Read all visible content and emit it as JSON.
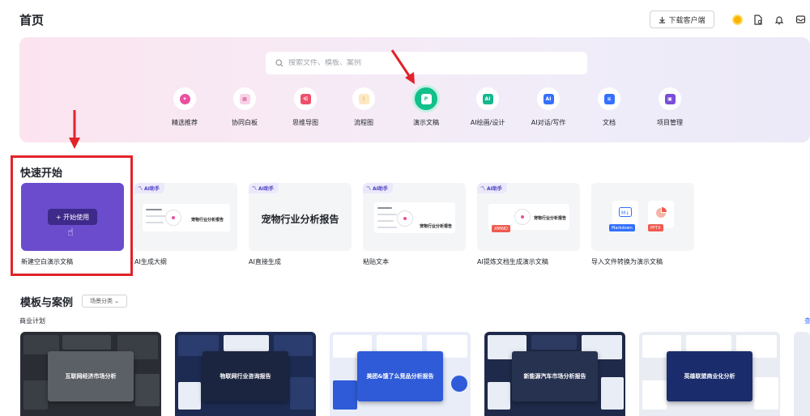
{
  "header": {
    "title": "首页",
    "download_label": "下载客户端"
  },
  "search": {
    "placeholder": "搜索文件、模板、案例"
  },
  "categories": [
    {
      "label": "精选推荐",
      "icon": "sparkle-icon",
      "color": "#e94fa0"
    },
    {
      "label": "协同白板",
      "icon": "whiteboard-icon",
      "color": "#e0549a"
    },
    {
      "label": "思维导图",
      "icon": "mindmap-icon",
      "color": "#ef4f6a"
    },
    {
      "label": "流程图",
      "icon": "flowchart-icon",
      "color": "#f5a623"
    },
    {
      "label": "演示文稿",
      "icon": "presentation-icon",
      "color": "#11c08a"
    },
    {
      "label": "AI绘画/设计",
      "icon": "ai-paint-icon",
      "color": "#14b88d"
    },
    {
      "label": "AI对话/写作",
      "icon": "ai-chat-icon",
      "color": "#3370ff"
    },
    {
      "label": "文档",
      "icon": "document-icon",
      "color": "#3370ff"
    },
    {
      "label": "项目管理",
      "icon": "project-icon",
      "color": "#7a4dd8"
    }
  ],
  "quick_start": {
    "title": "快速开始",
    "start_button": "+ 开始使用",
    "ai_badge": "AI助手",
    "big_title": "宠物行业分析报告",
    "mini_title": "宠物行业分析报告",
    "pill_markdown": "Markdown",
    "pill_pptx": "PPTX",
    "pill_xmind": "XMIND",
    "tiles": [
      {
        "caption": "新建空白演示文稿"
      },
      {
        "caption": "AI生成大纲"
      },
      {
        "caption": "AI直接生成"
      },
      {
        "caption": "粘贴文本"
      },
      {
        "caption": "AI提炼文档生成演示文稿"
      },
      {
        "caption": "导入文件转换为演示文稿"
      }
    ]
  },
  "templates": {
    "title": "模板与案例",
    "filter_label": "场景分类",
    "subsection": "商业计划",
    "see_all": "查",
    "items": [
      {
        "title": "互联网经济市场分析",
        "bg": "#2a2d33",
        "center": "#5b5f66"
      },
      {
        "title": "物联网行业咨询报告",
        "bg": "#1d2b52",
        "center": "#1c2540"
      },
      {
        "title": "美团&饿了么竞品分析报告",
        "bg": "#e8edf8",
        "center": "#2f5bd8"
      },
      {
        "title": "新能源汽车市场分析报告",
        "bg": "#1f2a4a",
        "center": "#26324f"
      },
      {
        "title": "英雄联盟商业化分析",
        "bg": "#e9ecf3",
        "center": "#1a2c6b"
      }
    ]
  }
}
